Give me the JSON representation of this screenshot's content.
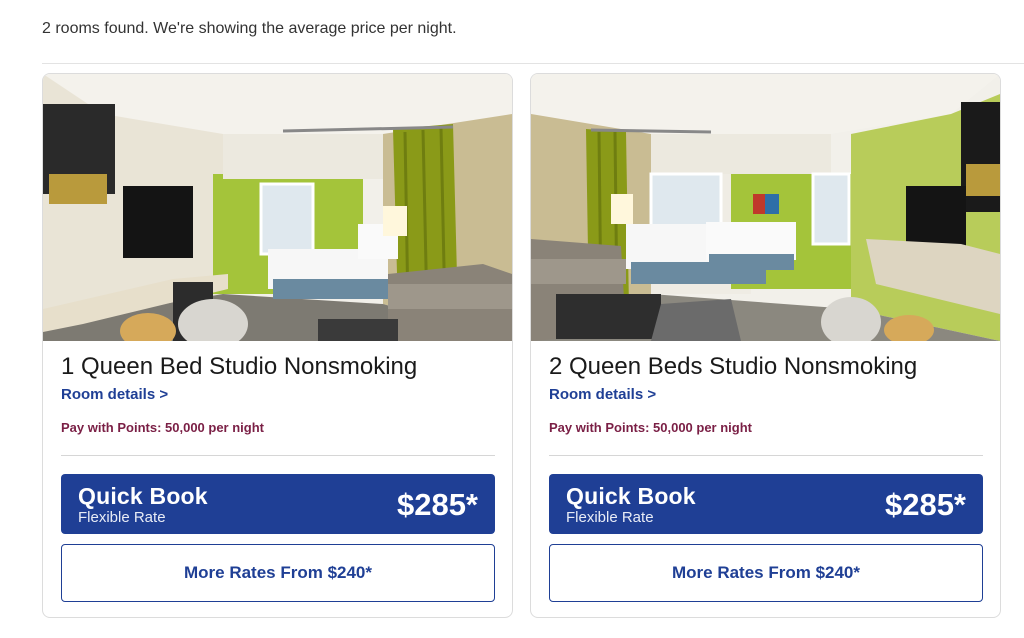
{
  "summary": "2 rooms found. We're showing the average price per night.",
  "rooms": [
    {
      "title": "1 Queen Bed Studio Nonsmoking",
      "details_link": "Room details >",
      "points": "Pay with Points: 50,000 per night",
      "quick_book": {
        "title": "Quick Book",
        "rate": "Flexible Rate",
        "price": "$285*"
      },
      "more_rates": "More Rates From $240*",
      "photo": "room-photo-1-queen"
    },
    {
      "title": "2 Queen Beds Studio Nonsmoking",
      "details_link": "Room details >",
      "points": "Pay with Points: 50,000 per night",
      "quick_book": {
        "title": "Quick Book",
        "rate": "Flexible Rate",
        "price": "$285*"
      },
      "more_rates": "More Rates From $240*",
      "photo": "room-photo-2-queen"
    }
  ],
  "colors": {
    "brand_blue": "#1f3f95",
    "points_text": "#7a1f45",
    "wall_green": "#a4c43a"
  }
}
